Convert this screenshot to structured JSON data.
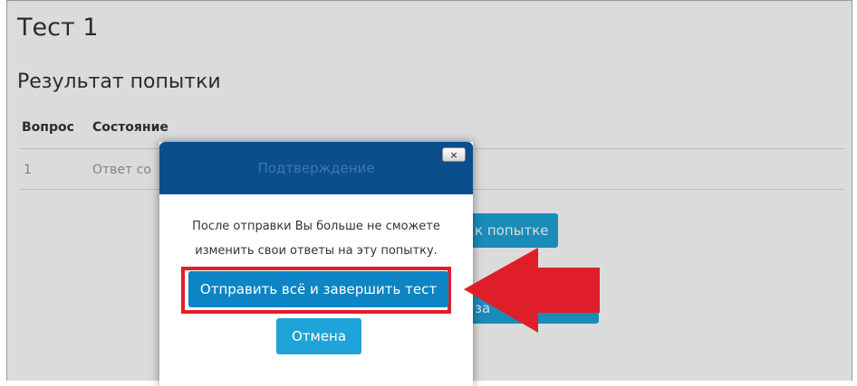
{
  "page": {
    "title": "Тест 1",
    "subtitle": "Результат попытки"
  },
  "table": {
    "headers": [
      "Вопрос",
      "Состояние"
    ],
    "rows": [
      {
        "question": "1",
        "status": "Ответ со"
      }
    ]
  },
  "background_buttons": {
    "return_label": "к попытке",
    "finish_label_fragment": "за"
  },
  "modal": {
    "title": "Подтверждение",
    "close_label": "×",
    "message_line1": "После отправки Вы больше не сможете",
    "message_line2": "изменить свои ответы на эту попытку.",
    "submit_label": "Отправить всё и завершить тест",
    "cancel_label": "Отмена"
  },
  "colors": {
    "modal_header": "#0a4f8c",
    "primary_button": "#0d84c3",
    "secondary_button": "#1fa3d8",
    "highlight": "#e01e2a",
    "arrow": "#e01e2a"
  },
  "icons": {
    "close": "close-icon",
    "annotation_arrow": "arrow-left-icon"
  }
}
